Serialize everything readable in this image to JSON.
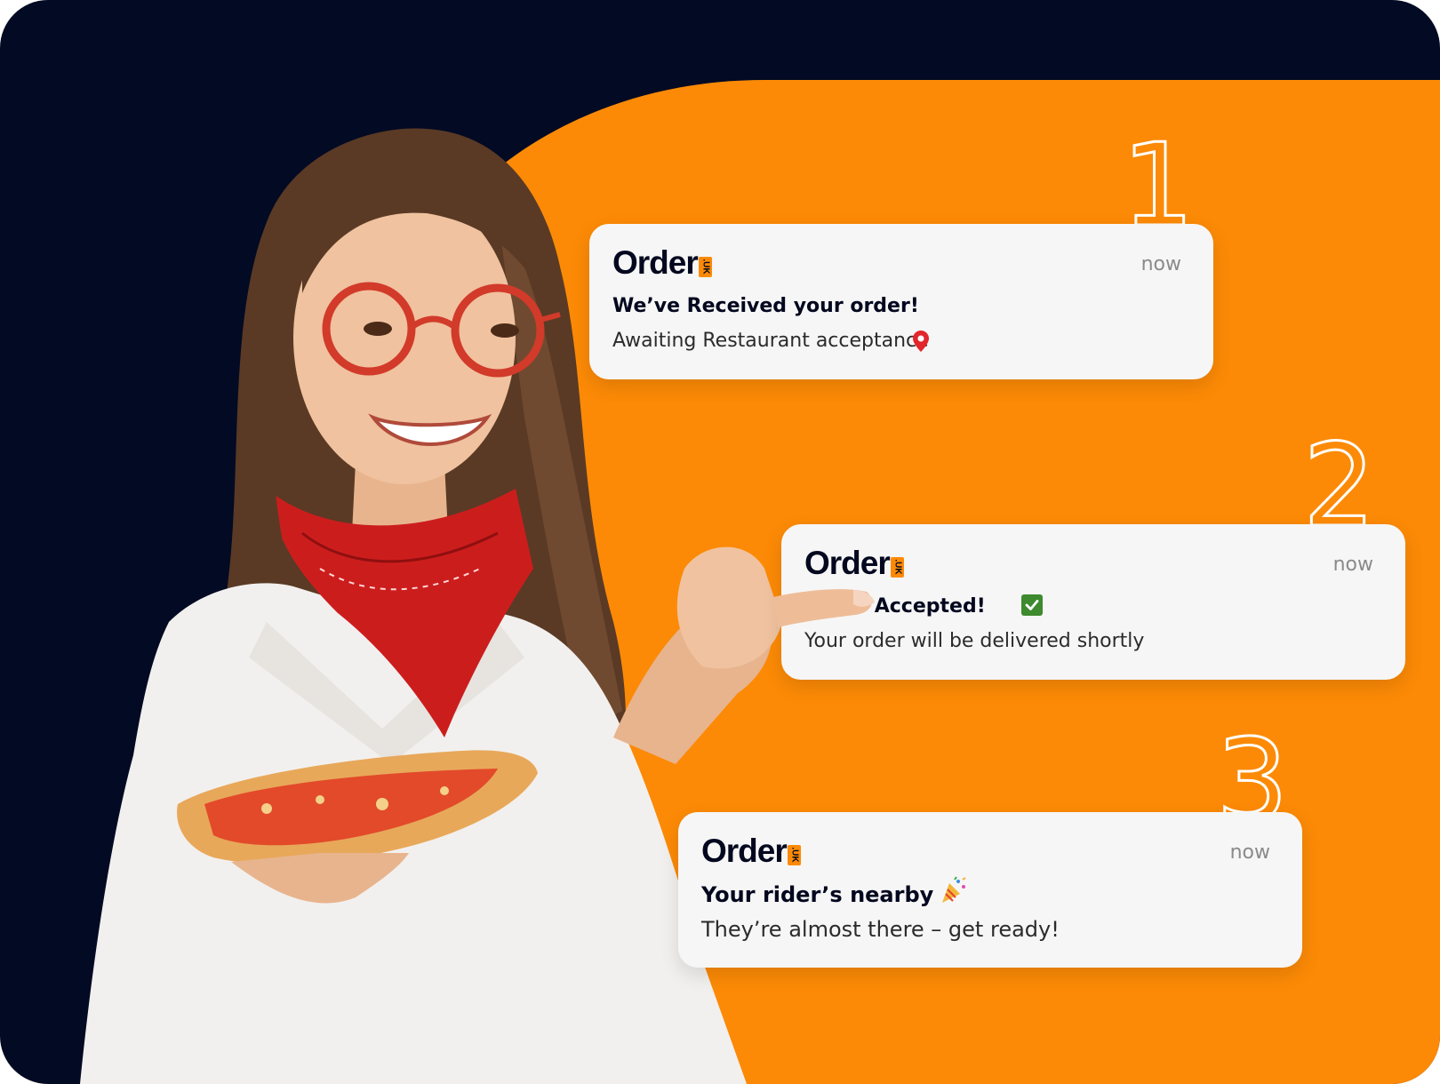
{
  "colors": {
    "navy": "#030a23",
    "orange": "#fc8a06",
    "card": "#f6f6f6",
    "check": "#3e8a2e"
  },
  "steps": [
    "1",
    "2",
    "3"
  ],
  "notifications": [
    {
      "brand": "Order",
      "brand_tag": ".UK",
      "time": "now",
      "title": "We’ve Received your order!",
      "message": "Awaiting Restaurant acceptance"
    },
    {
      "brand": "Order",
      "brand_tag": ".UK",
      "time": "now",
      "title": "Order Accepted!",
      "message": "Your order will be delivered shortly",
      "icon": "check-icon"
    },
    {
      "brand": "Order",
      "brand_tag": ".UK",
      "time": "now",
      "title": "Your rider’s nearby",
      "message": "They’re almost there – get ready!",
      "icon": "party-popper-icon"
    }
  ],
  "photo": {
    "subject": "woman-with-pizza-image"
  }
}
